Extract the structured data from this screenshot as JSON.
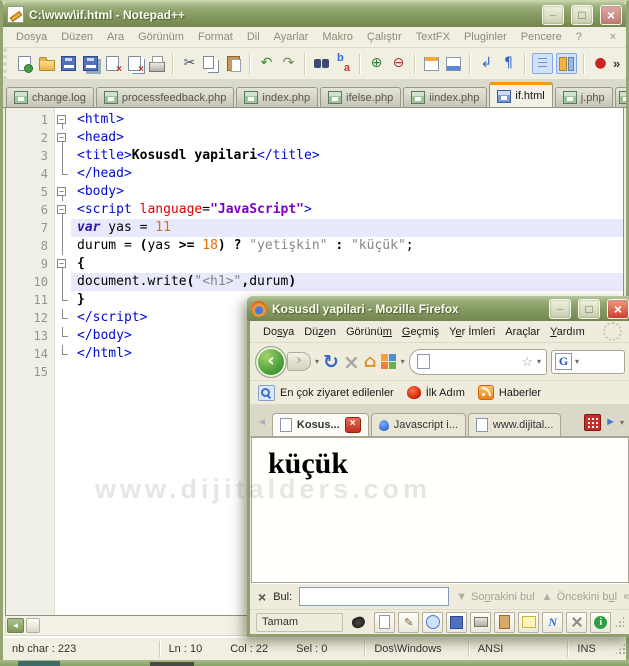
{
  "watermark": "www.dijitalders.com",
  "notepadpp": {
    "title": "C:\\www\\if.html - Notepad++",
    "menu": [
      "Dosya",
      "Düzen",
      "Ara",
      "Görünüm",
      "Format",
      "Dil",
      "Ayarlar",
      "Makro",
      "Çalıştır",
      "TextFX",
      "Pluginler",
      "Pencere",
      "?"
    ],
    "menubar_close": "×",
    "toolbar_overflow": "»",
    "toolbar": [
      {
        "name": "new-file",
        "kind": "page-new"
      },
      {
        "name": "open",
        "kind": "folder"
      },
      {
        "name": "save",
        "kind": "floppy"
      },
      {
        "name": "save-all",
        "kind": "floppy-all"
      },
      {
        "name": "close",
        "kind": "page-close"
      },
      {
        "name": "close-all",
        "kind": "page-close-all"
      },
      {
        "name": "print",
        "kind": "printer"
      },
      {
        "sep": true
      },
      {
        "name": "cut",
        "kind": "glyph",
        "glyph": "✂",
        "color": "#44505e"
      },
      {
        "name": "copy",
        "kind": "copy"
      },
      {
        "name": "paste",
        "kind": "paste"
      },
      {
        "sep": true
      },
      {
        "name": "undo",
        "kind": "glyph",
        "glyph": "↶",
        "color": "#2e8b2e"
      },
      {
        "name": "redo",
        "kind": "glyph",
        "glyph": "↷",
        "color": "#6a8b5e"
      },
      {
        "sep": true
      },
      {
        "name": "find",
        "kind": "binocular"
      },
      {
        "name": "replace",
        "kind": "replace"
      },
      {
        "sep": true
      },
      {
        "name": "zoom-in",
        "kind": "glyph",
        "glyph": "⊕",
        "color": "#2e7d32"
      },
      {
        "name": "zoom-out",
        "kind": "glyph",
        "glyph": "⊖",
        "color": "#b03030"
      },
      {
        "sep": true
      },
      {
        "name": "restore-default-zoom",
        "kind": "winov"
      },
      {
        "name": "synchronize-scrolling",
        "kind": "winov2"
      },
      {
        "sep": true
      },
      {
        "name": "word-wrap",
        "kind": "glyph",
        "glyph": "↲",
        "color": "#3465c8"
      },
      {
        "name": "show-all-characters",
        "kind": "glyph",
        "glyph": "¶",
        "color": "#3465c8"
      },
      {
        "sep": true
      },
      {
        "name": "indent-guide",
        "kind": "indent",
        "pressed": true
      },
      {
        "name": "doc-switcher",
        "kind": "docmap",
        "pressed": true
      },
      {
        "sep": true
      },
      {
        "name": "record-macro",
        "kind": "glyph",
        "glyph": "●",
        "color": "#cc2222"
      }
    ],
    "tabs": [
      {
        "label": "change.log"
      },
      {
        "label": "processfeedback.php"
      },
      {
        "label": "index.php"
      },
      {
        "label": "ifelse.php"
      },
      {
        "label": "iindex.php"
      },
      {
        "label": "if.html",
        "active": true
      },
      {
        "label": "j.php"
      },
      {
        "label": "",
        "partial": true
      }
    ],
    "code": {
      "lines": [
        {
          "n": 1,
          "fold": "box",
          "segs": [
            [
              "tag",
              "<html>"
            ]
          ]
        },
        {
          "n": 2,
          "fold": "box",
          "segs": [
            [
              "tag",
              "<head>"
            ]
          ]
        },
        {
          "n": 3,
          "fold": "line",
          "segs": [
            [
              "tag",
              "<title>"
            ],
            [
              "bold",
              "Kosusdl yapilari"
            ],
            [
              "tag",
              "</title>"
            ]
          ]
        },
        {
          "n": 4,
          "fold": "end",
          "segs": [
            [
              "tag",
              "</head>"
            ]
          ]
        },
        {
          "n": 5,
          "fold": "box",
          "segs": [
            [
              "tag",
              "<body>"
            ]
          ]
        },
        {
          "n": 6,
          "fold": "box",
          "segs": [
            [
              "tag",
              "<script "
            ],
            [
              "attr",
              "language"
            ],
            [
              "plain",
              "="
            ],
            [
              "val",
              "\"JavaScript\""
            ],
            [
              "tag",
              ">"
            ]
          ]
        },
        {
          "n": 7,
          "fold": "line",
          "hl": true,
          "segs": [
            [
              "kw",
              "var"
            ],
            [
              "plain",
              " yas = "
            ],
            [
              "num",
              "11"
            ]
          ]
        },
        {
          "n": 8,
          "fold": "line",
          "segs": [
            [
              "plain",
              "durum = "
            ],
            [
              "op",
              "("
            ],
            [
              "plain",
              "yas "
            ],
            [
              "op",
              ">="
            ],
            [
              "plain",
              " "
            ],
            [
              "num",
              "18"
            ],
            [
              "op",
              ")"
            ],
            [
              "plain",
              " "
            ],
            [
              "op",
              "?"
            ],
            [
              "plain",
              " "
            ],
            [
              "str",
              "\"yetişkin\""
            ],
            [
              "plain",
              " "
            ],
            [
              "op",
              ":"
            ],
            [
              "plain",
              " "
            ],
            [
              "str",
              "\"küçük\""
            ],
            [
              "plain",
              ";"
            ]
          ]
        },
        {
          "n": 9,
          "fold": "box",
          "segs": [
            [
              "op",
              "{"
            ]
          ]
        },
        {
          "n": 10,
          "fold": "line",
          "hl": true,
          "segs": [
            [
              "plain",
              "document.write"
            ],
            [
              "op",
              "("
            ],
            [
              "str",
              "\"<h1>\""
            ],
            [
              "op",
              ","
            ],
            [
              "plain",
              "durum"
            ],
            [
              "op",
              ")"
            ]
          ]
        },
        {
          "n": 11,
          "fold": "end",
          "segs": [
            [
              "op",
              "}"
            ]
          ]
        },
        {
          "n": 12,
          "fold": "end",
          "segs": [
            [
              "tag",
              "</script>"
            ]
          ]
        },
        {
          "n": 13,
          "fold": "end",
          "segs": [
            [
              "tag",
              "</body>"
            ]
          ]
        },
        {
          "n": 14,
          "fold": "end",
          "segs": [
            [
              "tag",
              "</html>"
            ]
          ]
        },
        {
          "n": 15,
          "fold": "none",
          "segs": []
        }
      ]
    },
    "statusbar": {
      "chars": "nb char : 223",
      "ln": "Ln : 10",
      "col": "Col : 22",
      "sel": "Sel : 0",
      "eol": "Dos\\Windows",
      "encoding": "ANSI",
      "mode": "INS"
    }
  },
  "firefox": {
    "title": "Kosusdl yapilari - Mozilla Firefox",
    "menu": [
      {
        "label": "Dosya",
        "u": 2
      },
      {
        "label": "Düzen",
        "u": 2
      },
      {
        "label": "Görünüm",
        "u": 6
      },
      {
        "label": "Geçmiş",
        "u": 0
      },
      {
        "label": "Yer İmleri",
        "u": 1
      },
      {
        "label": "Araçlar",
        "u": -1
      },
      {
        "label": "Yardım",
        "u": 0
      }
    ],
    "search_engine": "G",
    "bookmarks": [
      {
        "label": "En çok ziyaret edilenler",
        "icon": "visited"
      },
      {
        "label": "İlk Adım",
        "icon": "firefox"
      },
      {
        "label": "Haberler",
        "icon": "rss"
      }
    ],
    "tabs": [
      {
        "label": "Kosus...",
        "icon": "page",
        "active": true,
        "close": true
      },
      {
        "label": "Javascript i...",
        "icon": "script"
      },
      {
        "label": "www.dijital...",
        "icon": "page"
      }
    ],
    "content_heading": "küçük",
    "findbar": {
      "label": "Bul:",
      "value": "",
      "next": "Sonrakini bul",
      "next_u": 2,
      "prev": "Öncekini bul",
      "prev_u": 10
    },
    "statusbar": {
      "text": "Tamam",
      "buttons": [
        "bug",
        "new-page",
        "edit",
        "web",
        "save",
        "print",
        "clipboard",
        "note",
        "lightning",
        "tools",
        "info"
      ]
    }
  }
}
